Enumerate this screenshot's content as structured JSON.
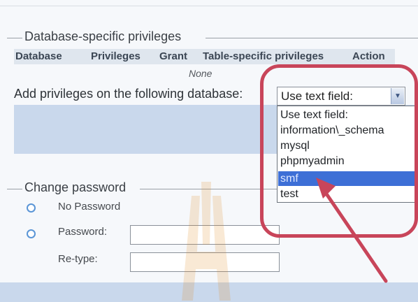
{
  "db_privileges": {
    "legend": "Database-specific privileges",
    "columns": [
      "Database",
      "Privileges",
      "Grant",
      "Table-specific privileges",
      "Action"
    ],
    "empty_text": "None",
    "add_label": "Add privileges on the following database:",
    "select_value": "Use text field:",
    "options": [
      "Use text field:",
      "information\\_schema",
      "mysql",
      "phpmyadmin",
      "smf",
      "test"
    ],
    "selected_option": "smf"
  },
  "change_password": {
    "legend": "Change password",
    "no_password_label": "No Password",
    "password_label": "Password:",
    "retype_label": "Re-type:",
    "password_value": "",
    "retype_value": ""
  },
  "colors": {
    "highlight": "#c8455a",
    "selected_option_bg": "#3d6fd6",
    "header_bg": "#dfe6ee",
    "bar_bg": "#c9d8ec"
  }
}
